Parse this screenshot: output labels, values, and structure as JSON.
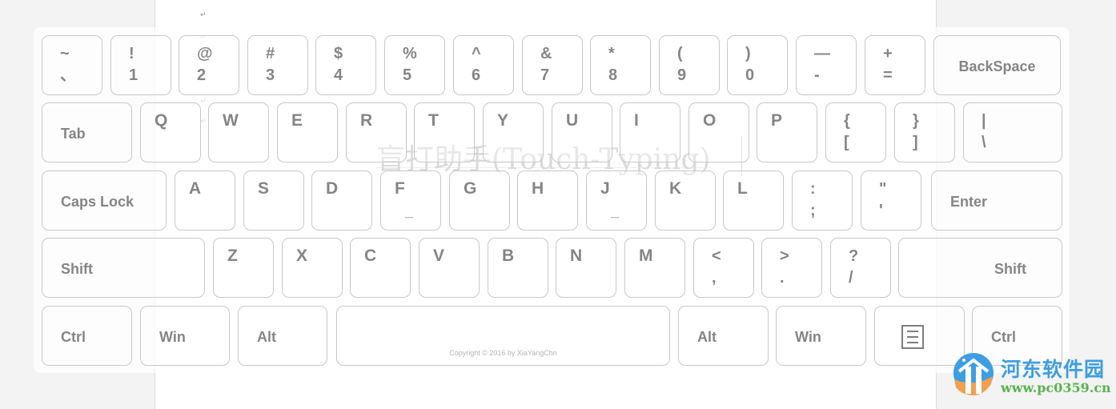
{
  "document": {
    "title": "盲打助手(Touch-Typing)",
    "paragraph_mark": "↵"
  },
  "keyboard": {
    "row1": [
      {
        "top": "~",
        "bottom": "、"
      },
      {
        "top": "!",
        "bottom": "1"
      },
      {
        "top": "@",
        "bottom": "2"
      },
      {
        "top": "#",
        "bottom": "3"
      },
      {
        "top": "$",
        "bottom": "4"
      },
      {
        "top": "%",
        "bottom": "5"
      },
      {
        "top": "^",
        "bottom": "6"
      },
      {
        "top": "&",
        "bottom": "7"
      },
      {
        "top": "*",
        "bottom": "8"
      },
      {
        "top": "(",
        "bottom": "9"
      },
      {
        "top": ")",
        "bottom": "0"
      },
      {
        "top": "—",
        "bottom": "-"
      },
      {
        "top": "+",
        "bottom": "="
      }
    ],
    "backspace": "BackSpace",
    "tab": "Tab",
    "row2": [
      "Q",
      "W",
      "E",
      "R",
      "T",
      "Y",
      "U",
      "I",
      "O",
      "P"
    ],
    "row2_symbols": [
      {
        "top": "{",
        "bottom": "["
      },
      {
        "top": "}",
        "bottom": "]"
      }
    ],
    "backslash": {
      "top": "|",
      "bottom": "\\"
    },
    "caps_lock": "Caps Lock",
    "row3": [
      "A",
      "S",
      "D",
      "F",
      "G",
      "H",
      "J",
      "K",
      "L"
    ],
    "home_marker": "_",
    "row3_symbols": [
      {
        "top": ":",
        "bottom": ";"
      },
      {
        "top": "\"",
        "bottom": "'"
      }
    ],
    "enter": "Enter",
    "shift_left": "Shift",
    "row4": [
      "Z",
      "X",
      "C",
      "V",
      "B",
      "N",
      "M"
    ],
    "row4_symbols": [
      {
        "top": "<",
        "bottom": ","
      },
      {
        "top": ">",
        "bottom": "."
      },
      {
        "top": "?",
        "bottom": "/"
      }
    ],
    "shift_right": "Shift",
    "ctrl_left": "Ctrl",
    "win_left": "Win",
    "alt_left": "Alt",
    "space_copyright": "Copyright ©  2016 by XiaYangChn",
    "alt_right": "Alt",
    "win_right": "Win",
    "menu_icon": "menu-icon",
    "ctrl_right": "Ctrl"
  },
  "watermark": {
    "name": "河东软件园",
    "url": "www.pc0359.cn",
    "colors": {
      "blue": "#3d9ee3",
      "orange": "#f0a050",
      "green": "#58b34d"
    }
  }
}
